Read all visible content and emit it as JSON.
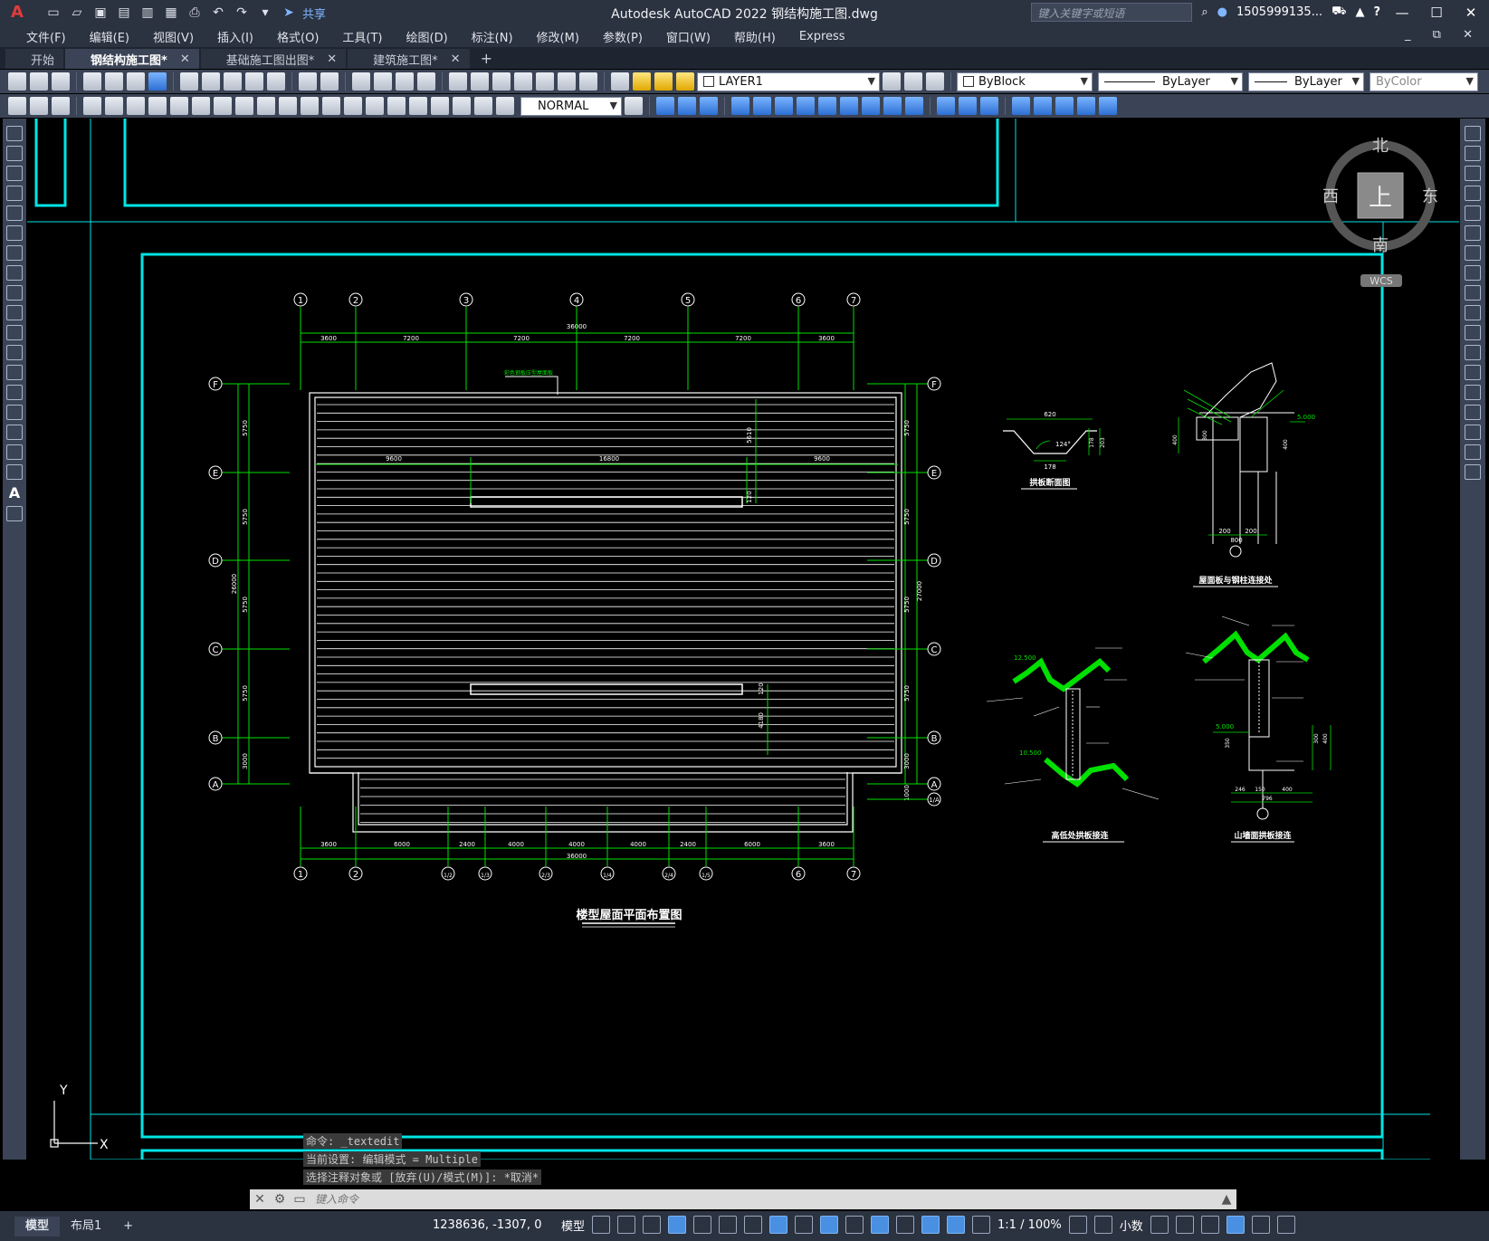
{
  "titlebar": {
    "app_logo": "A",
    "share_label": "共享",
    "title": "Autodesk AutoCAD 2022    钢结构施工图.dwg",
    "search_placeholder": "键入关键字或短语",
    "user": "1505999135...",
    "help": "?"
  },
  "menu": [
    "文件(F)",
    "编辑(E)",
    "视图(V)",
    "插入(I)",
    "格式(O)",
    "工具(T)",
    "绘图(D)",
    "标注(N)",
    "修改(M)",
    "参数(P)",
    "窗口(W)",
    "帮助(H)",
    "Express"
  ],
  "tabs": [
    {
      "label": "开始",
      "active": false,
      "close": false
    },
    {
      "label": "钢结构施工图*",
      "active": true,
      "close": true
    },
    {
      "label": "基础施工图出图*",
      "active": false,
      "close": true
    },
    {
      "label": "建筑施工图*",
      "active": false,
      "close": true
    }
  ],
  "toolbar1": {
    "layer": "LAYER1",
    "color": "ByBlock",
    "linetype": "ByLayer",
    "lineweight": "ByLayer",
    "plotstyle": "ByColor"
  },
  "toolbar2": {
    "dimstyle": "NORMAL"
  },
  "viewcube": {
    "north": "北",
    "south": "南",
    "east": "东",
    "west": "西",
    "face": "上",
    "wcs": "WCS"
  },
  "ucs": {
    "x": "X",
    "y": "Y"
  },
  "drawing": {
    "main_title": "楼型屋面平面布置图",
    "top_axes": [
      "1",
      "2",
      "3",
      "4",
      "5",
      "6",
      "7"
    ],
    "top_total": "36000",
    "top_dims": [
      "3600",
      "7200",
      "7200",
      "7200",
      "7200",
      "3600"
    ],
    "side_axes": [
      "F",
      "E",
      "D",
      "C",
      "B",
      "A"
    ],
    "side_dims": [
      "5750",
      "5750",
      "5750",
      "5750",
      "3000"
    ],
    "left_total": "26000",
    "right_total": "27000",
    "right_extra": "1000",
    "right_axis_extra": "1/A",
    "inner_dims": [
      "9600",
      "16800",
      "9600"
    ],
    "inner_vert": [
      "5610",
      "120",
      "120",
      "4180"
    ],
    "bottom_axes": [
      "1",
      "2",
      "1/2",
      "1/3",
      "2/3",
      "1/4",
      "2/4",
      "1/5",
      "6",
      "7"
    ],
    "bottom_dims": [
      "3600",
      "6000",
      "2400",
      "4000",
      "4000",
      "4000",
      "2400",
      "6000",
      "3600"
    ],
    "bottom_total": "36000",
    "leader_note": "彩色钢板压型屋面板",
    "detail1": {
      "title": "拱板断面图",
      "dims": [
        "620",
        "178",
        "203",
        "178"
      ],
      "angle": "124°"
    },
    "detail2": {
      "title": "屋面板与钢柱连接处",
      "dims": [
        "400",
        "300",
        "200",
        "200",
        "800",
        "400"
      ],
      "elev": "5.000"
    },
    "detail3": {
      "title": "高低处拱板接连",
      "elev": [
        "12.500",
        "10.500"
      ]
    },
    "detail4": {
      "title": "山墙面拱板接连",
      "dims": [
        "246",
        "150",
        "400",
        "796",
        "350",
        "300",
        "400"
      ],
      "elev": "5.000"
    }
  },
  "command": {
    "history": [
      "命令: _textedit",
      "当前设置: 编辑模式 = Multiple",
      "选择注释对象或 [放弃(U)/模式(M)]: *取消*"
    ],
    "placeholder": "键入命令"
  },
  "status": {
    "layouts": [
      "模型",
      "布局1"
    ],
    "coords": "1238636, -1307, 0",
    "space": "模型",
    "scale": "1:1 / 100%",
    "units": "小数"
  },
  "colors": {
    "frame": "#00e5e5",
    "green": "#00e000",
    "white": "#ffffff",
    "accent": "#4a90e2"
  }
}
